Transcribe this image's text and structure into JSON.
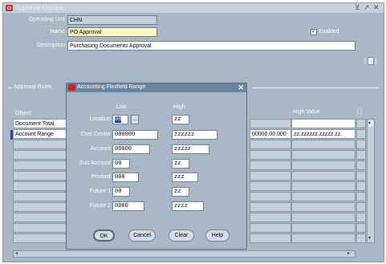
{
  "window": {
    "title": "Approval Groups",
    "controls": [
      "⊻",
      "↗",
      "✕"
    ]
  },
  "header": {
    "operating_unit_label": "Operating Unit",
    "operating_unit_value": "CHN",
    "name_label": "Name",
    "name_value": "PO Approval",
    "enabled_label": "Enabled",
    "enabled_checked": true,
    "description_label": "Description",
    "description_value": "Purchasing Documents Approval",
    "folder_button_label": "[ ]"
  },
  "rules": {
    "section_label": "Approval Rules",
    "col_object": "Object",
    "col_high_value": "High Value",
    "col_bracket": "[ ]",
    "rows": [
      {
        "object": "Document Total",
        "high_value": ""
      },
      {
        "object": "Account Range",
        "mid_value": "00000.00.000",
        "high_value": "zz.zzzzzz.zzzzz.zz."
      }
    ]
  },
  "dialog": {
    "title": "Accounting Flexfield Range",
    "col_low": "Low",
    "col_high": "High",
    "fields": [
      {
        "label": "Location",
        "low": "00",
        "high": "zz"
      },
      {
        "label": "Cost Centre",
        "low": "000000",
        "high": "zzzzzz"
      },
      {
        "label": "Account",
        "low": "00000",
        "high": "zzzzz"
      },
      {
        "label": "Sub Account",
        "low": "00",
        "high": "zz"
      },
      {
        "label": "Product",
        "low": "000",
        "high": "zzz"
      },
      {
        "label": "Future 1",
        "low": "00",
        "high": "zz"
      },
      {
        "label": "Future 2",
        "low": "0000",
        "high": "zzzz"
      }
    ],
    "lov_button": "...",
    "ok_label": "OK",
    "cancel_label": "Cancel",
    "clear_label": "Clear",
    "help_label": "Help"
  },
  "colors": {
    "window_bg": "#a9b7c6",
    "field_required": "#fff8c0",
    "field_readonly": "#c5cfd9",
    "dialog_title": "#6d85a0",
    "selection": "#2a3fa8"
  }
}
